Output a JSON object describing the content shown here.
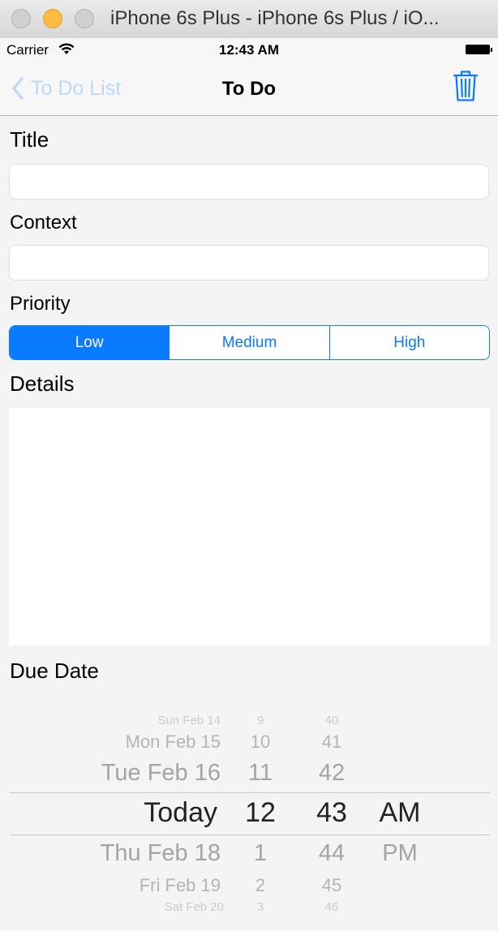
{
  "window": {
    "title": "iPhone 6s Plus - iPhone 6s Plus / iO..."
  },
  "status_bar": {
    "carrier": "Carrier",
    "time": "12:43 AM"
  },
  "nav": {
    "back_label": "To Do List",
    "title": "To Do"
  },
  "form": {
    "title_label": "Title",
    "title_value": "",
    "context_label": "Context",
    "context_value": "",
    "priority_label": "Priority",
    "priority_options": [
      "Low",
      "Medium",
      "High"
    ],
    "priority_selected": "Low",
    "details_label": "Details",
    "details_value": "",
    "due_date_label": "Due Date"
  },
  "date_picker": {
    "dates": [
      "Sun Feb 14",
      "Mon Feb 15",
      "Tue Feb 16",
      "Today",
      "Thu Feb 18",
      "Fri Feb 19",
      "Sat Feb 20"
    ],
    "hours": [
      "9",
      "10",
      "11",
      "12",
      "1",
      "2",
      "3"
    ],
    "minutes": [
      "40",
      "41",
      "42",
      "43",
      "44",
      "45",
      "46"
    ],
    "periods": [
      "AM",
      "PM"
    ],
    "selected": {
      "date": "Today",
      "hour": "12",
      "minute": "43",
      "period": "AM"
    }
  },
  "colors": {
    "accent": "#0a7aff",
    "back_disabled": "#bcdaf8",
    "background": "#f4f4f4"
  }
}
